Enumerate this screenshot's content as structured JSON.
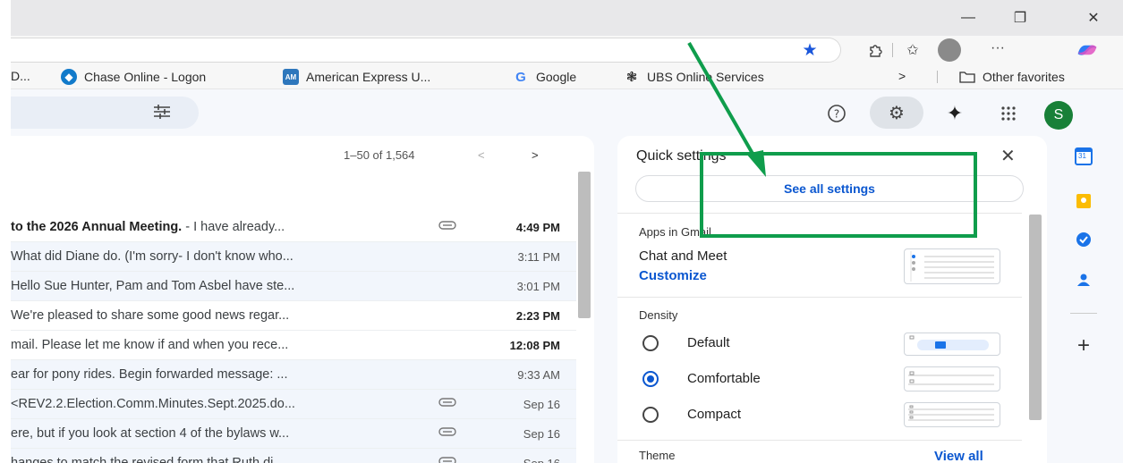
{
  "browser": {
    "window_controls": {
      "minimize": "—",
      "restore": "❐",
      "close": "✕"
    },
    "toolbar_icons": [
      "star-icon",
      "extensions-icon",
      "favorites-icon",
      "profile-icon",
      "more-icon",
      "copilot-icon"
    ],
    "more_label": "···",
    "favorites": [
      {
        "label": "D...",
        "icon": "generic-icon"
      },
      {
        "label": "Chase Online - Logon",
        "icon": "chase-icon"
      },
      {
        "label": "American Express U...",
        "icon": "amex-icon"
      },
      {
        "label": "Google",
        "icon": "google-icon"
      },
      {
        "label": "UBS Online Services",
        "icon": "ubs-icon"
      }
    ],
    "favorites_overflow": ">",
    "other_favorites": "Other favorites"
  },
  "header": {
    "avatar_letter": "S",
    "icons": [
      "help-icon",
      "settings-icon",
      "gemini-icon",
      "apps-icon"
    ]
  },
  "list": {
    "pager_range": "1–50 of 1,564",
    "prev": "<",
    "next": ">",
    "rows": [
      {
        "subject": "to the 2026 Annual Meeting.",
        "snippet": " - I have already...",
        "attach": true,
        "time": "4:49 PM",
        "unread": true
      },
      {
        "subject": "",
        "snippet": "What did Diane do. (I'm sorry- I don't know who...",
        "attach": false,
        "time": "3:11 PM",
        "unread": false
      },
      {
        "subject": "",
        "snippet": " Hello Sue Hunter, Pam and Tom Asbel have ste...",
        "attach": false,
        "time": "3:01 PM",
        "unread": false
      },
      {
        "subject": "",
        "snippet": "We're pleased to share some good news regar...",
        "attach": false,
        "time": "2:23 PM",
        "unread": true
      },
      {
        "subject": "",
        "snippet": " mail. Please let me know if and when you rece...",
        "attach": false,
        "time": "12:08 PM",
        "unread": true
      },
      {
        "subject": "",
        "snippet": "ear for pony rides. Begin forwarded message: ...",
        "attach": false,
        "time": "9:33 AM",
        "unread": false
      },
      {
        "subject": "",
        "snippet": "<REV2.2.Election.Comm.Minutes.Sept.2025.do...",
        "attach": true,
        "time": "Sep 16",
        "unread": false
      },
      {
        "subject": "",
        "snippet": "ere, but if you look at section 4 of the bylaws w...",
        "attach": true,
        "time": "Sep 16",
        "unread": false
      },
      {
        "subject": "",
        "snippet": "hanges to match the revised form that Ruth di...",
        "attach": true,
        "time": "Sep 16",
        "unread": false
      }
    ]
  },
  "quick_settings": {
    "title": "Quick settings",
    "close": "✕",
    "see_all": "See all settings",
    "apps_label": "Apps in Gmail",
    "chat_label": "Chat and Meet",
    "customize": "Customize",
    "density_label": "Density",
    "density_options": [
      {
        "label": "Default",
        "selected": false
      },
      {
        "label": "Comfortable",
        "selected": true
      },
      {
        "label": "Compact",
        "selected": false
      }
    ],
    "theme_label": "Theme",
    "view_all": "View all"
  },
  "side_panel": {
    "calendar_day": "31",
    "icons": [
      "calendar-icon",
      "keep-icon",
      "tasks-icon",
      "contacts-icon",
      "add-icon"
    ],
    "add": "+"
  },
  "colors": {
    "annotation": "#0f9d4c",
    "link_blue": "#0b57d0",
    "avatar_green": "#188038"
  }
}
